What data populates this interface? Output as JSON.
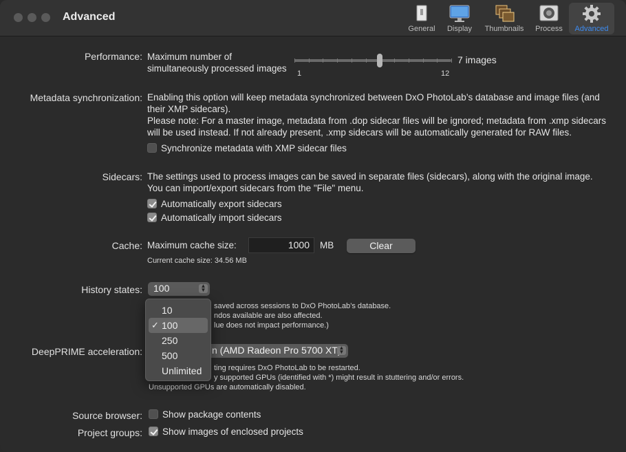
{
  "window": {
    "title": "Advanced"
  },
  "toolbar": {
    "items": [
      {
        "label": "General",
        "icon": "general-icon"
      },
      {
        "label": "Display",
        "icon": "display-icon"
      },
      {
        "label": "Thumbnails",
        "icon": "thumbnails-icon"
      },
      {
        "label": "Process",
        "icon": "process-icon"
      },
      {
        "label": "Advanced",
        "icon": "gear-icon",
        "active": true
      }
    ],
    "accent": "#3d8bf0"
  },
  "performance": {
    "label": "Performance:",
    "desc_line1": "Maximum number of",
    "desc_line2": "simultaneously processed images",
    "min_label": "1",
    "max_label": "12",
    "value_label": "7 images",
    "value": 7,
    "min": 1,
    "max": 12
  },
  "metadata": {
    "label": "Metadata synchronization:",
    "lines": [
      "Enabling this option will keep metadata synchronized between DxO PhotoLab’s database and image files (and",
      "their XMP sidecars).",
      "Please note: For a master image, metadata from .dop sidecar files will be ignored; metadata from .xmp sidecars",
      "will be used instead. If not already present, .xmp sidecars will be automatically generated for RAW files."
    ],
    "checkbox_label": "Synchronize metadata with XMP sidecar files",
    "checked": false
  },
  "sidecars": {
    "label": "Sidecars:",
    "lines": [
      "The settings used to process images can be saved in separate files (sidecars), along with the original image.",
      "You can import/export sidecars from the \"File\" menu."
    ],
    "export_label": "Automatically export sidecars",
    "export_checked": true,
    "import_label": "Automatically import sidecars",
    "import_checked": true
  },
  "cache": {
    "label": "Cache:",
    "max_label": "Maximum cache size:",
    "value": "1000",
    "unit": "MB",
    "clear_label": "Clear",
    "current_label": "Current cache size: 34.56 MB"
  },
  "history": {
    "label": "History states:",
    "value": "100",
    "desc_line1": "saved across sessions to DxO PhotoLab’s database.",
    "desc_line2": "ndos available are also affected.",
    "desc_line3": "lue does not impact performance.)",
    "menu_options": [
      "10",
      "100",
      "250",
      "500",
      "Unlimited"
    ],
    "selected_index": 1,
    "check_glyph": "✓"
  },
  "deepprime": {
    "label": "DeepPRIME acceleration:",
    "value": "n (AMD Radeon Pro 5700 XT)",
    "desc_line1": "ting requires DxO PhotoLab to be restarted.",
    "desc_line2": "y supported GPUs (identified with *) might result in stuttering and/or errors.",
    "desc_line3": "Unsupported GPUs are automatically disabled."
  },
  "source_browser": {
    "label": "Source browser:",
    "checkbox_label": "Show package contents",
    "checked": false
  },
  "project_groups": {
    "label": "Project groups:",
    "checkbox_label": "Show images of enclosed projects",
    "checked": true
  }
}
